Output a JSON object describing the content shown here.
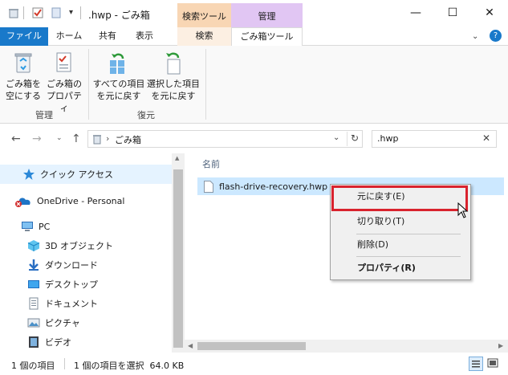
{
  "window": {
    "title": ".hwp - ごみ箱",
    "tool_tab_search": "検索ツール",
    "tool_tab_manage": "管理",
    "minimize": "—",
    "maximize": "☐",
    "close": "✕"
  },
  "ribbon_tabs": [
    "ファイル",
    "ホーム",
    "共有",
    "表示",
    "検索",
    "ごみ箱ツール"
  ],
  "ribbon": {
    "empty_bin_label": [
      "ごみ箱を",
      "空にする"
    ],
    "bin_properties_label": [
      "ごみ箱の",
      "プロパティ"
    ],
    "group_manage": "管理",
    "restore_all_label": [
      "すべての項目",
      "を元に戻す"
    ],
    "restore_selected_label": [
      "選択した項目",
      "を元に戻す"
    ],
    "group_restore": "復元"
  },
  "address": {
    "path": "ごみ箱",
    "separator": "›",
    "search_value": ".hwp"
  },
  "nav": {
    "items": [
      {
        "label": "クイック アクセス",
        "icon": "star-icon"
      },
      {
        "label": "OneDrive - Personal",
        "icon": "cloud-icon"
      },
      {
        "label": "PC",
        "icon": "pc-icon"
      },
      {
        "label": "3D オブジェクト",
        "icon": "cube-icon"
      },
      {
        "label": "ダウンロード",
        "icon": "download-icon"
      },
      {
        "label": "デスクトップ",
        "icon": "desktop-icon"
      },
      {
        "label": "ドキュメント",
        "icon": "document-icon"
      },
      {
        "label": "ピクチャ",
        "icon": "picture-icon"
      },
      {
        "label": "ビデオ",
        "icon": "video-icon"
      }
    ]
  },
  "content": {
    "column_name": "名前",
    "file_name": "flash-drive-recovery.hwp"
  },
  "context_menu": {
    "items": [
      "元に戻す(E)",
      "切り取り(T)",
      "削除(D)",
      "プロパティ(R)"
    ],
    "highlight_color": "#d9232e"
  },
  "status": {
    "item_count": "1 個の項目",
    "selection": "1 個の項目を選択  64.0 KB"
  },
  "colors": {
    "file_tab": "#1979ca",
    "search_tools": "#f8d6b4",
    "recycle_tools": "#e1c6f3",
    "selection": "#cce8ff"
  }
}
